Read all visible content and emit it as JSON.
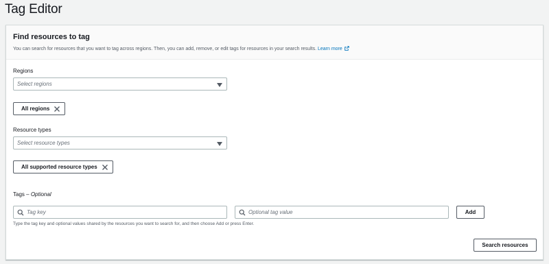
{
  "page": {
    "title": "Tag Editor"
  },
  "panel": {
    "title": "Find resources to tag",
    "description": "You can search for resources that you want to tag across regions. Then, you can add, remove, or edit tags for resources in your search results.",
    "learn_more": "Learn more"
  },
  "regions": {
    "label": "Regions",
    "placeholder": "Select regions",
    "token": "All regions"
  },
  "resource_types": {
    "label": "Resource types",
    "placeholder": "Select resource types",
    "token": "All supported resource types"
  },
  "tags": {
    "label": "Tags",
    "optional": "Optional",
    "key_placeholder": "Tag key",
    "value_placeholder": "Optional tag value",
    "add_label": "Add",
    "hint": "Type the tag key and optional values shared by the resources you want to search for, and then choose Add or press Enter."
  },
  "actions": {
    "search_label": "Search resources"
  },
  "icons": {
    "caret": "caret-down-icon",
    "remove": "close-icon",
    "search": "search-icon",
    "external": "external-link-icon"
  },
  "colors": {
    "link": "#0073bb",
    "border": "#aab7b8",
    "text": "#16191f",
    "muted": "#545b64"
  }
}
